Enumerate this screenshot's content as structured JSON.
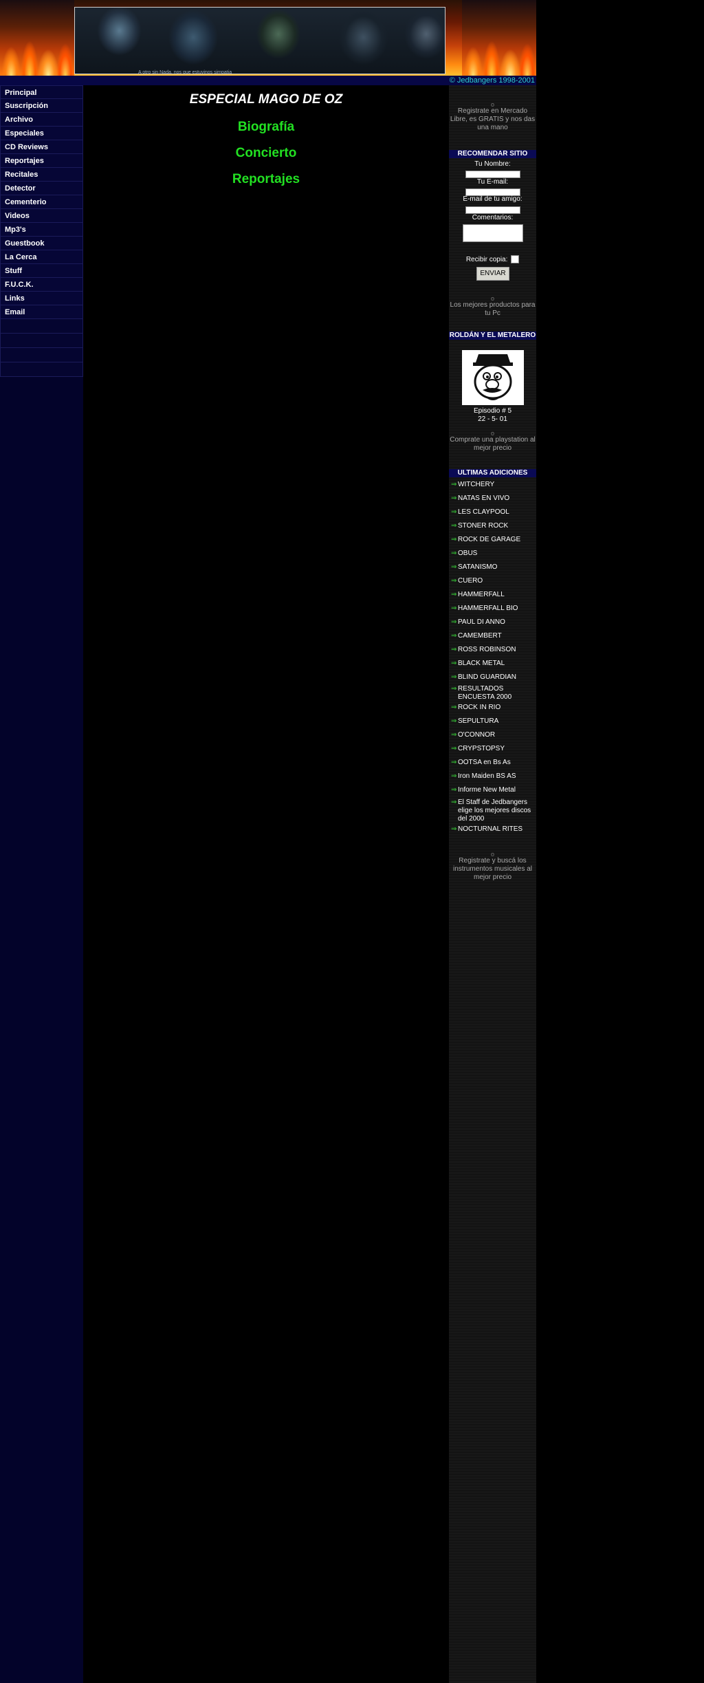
{
  "header": {
    "banner_caption": "A otro sin Nada, nos que estuvinos simpatia"
  },
  "strip": {
    "copyright": "© Jedbangers 1998-2001"
  },
  "nav": {
    "items": [
      "Principal",
      "Suscripción",
      "Archivo",
      "Especiales",
      "CD Reviews",
      "Reportajes",
      "Recitales",
      "Detector",
      "Cementerio",
      "Videos",
      "Mp3's",
      "Guestbook",
      "La Cerca",
      "Stuff",
      "F.U.C.K.",
      "Links",
      "Email"
    ]
  },
  "center": {
    "title": "ESPECIAL MAGO DE OZ",
    "links": [
      "Biografía",
      "Concierto",
      "Reportajes"
    ]
  },
  "right": {
    "bullet": "o",
    "ad_mercadolibre": "Registrate en Mercado Libre, es GRATIS y nos das una mano",
    "recommend": {
      "header": "RECOMENDAR SITIO",
      "name_label": "Tu Nombre:",
      "email_label": "Tu E-mail:",
      "friend_label": "E-mail de tu amigo:",
      "comments_label": "Comentarios:",
      "copy_label": "Recibir copia:",
      "send_label": "ENVIAR"
    },
    "ad_pc": "Los mejores productos para tu Pc",
    "roldan": {
      "header": "ROLDÁN Y EL METALERO",
      "episode": "Episodio # 5",
      "date": "22 - 5- 01"
    },
    "ad_playstation": "Comprate una playstation al mejor precio",
    "additions": {
      "header": "ULTIMAS ADICIONES",
      "arrow": "⇒",
      "items": [
        "WITCHERY",
        "NATAS EN VIVO",
        "LES CLAYPOOL",
        "STONER ROCK",
        "ROCK DE GARAGE",
        "OBUS",
        "SATANISMO",
        "CUERO",
        "HAMMERFALL",
        "HAMMERFALL BIO",
        "PAUL DI ANNO",
        "CAMEMBERT",
        "ROSS ROBINSON",
        "BLACK METAL",
        "BLIND GUARDIAN",
        "RESULTADOS ENCUESTA 2000",
        "ROCK IN RIO",
        "SEPULTURA",
        "O'CONNOR",
        "CRYPSTOPSY",
        "OOTSA en Bs As",
        "Iron Maiden BS AS",
        "Informe New Metal",
        "El Staff de Jedbangers elige los mejores discos del 2000",
        "NOCTURNAL RITES"
      ]
    },
    "ad_instruments": "Registrate y buscá los instrumentos musicales al mejor precio"
  },
  "colors": {
    "link_green": "#22e022",
    "nav_bg": "#060636",
    "header_blue": "#0a0a55",
    "copyright_cyan": "#2fd0d0"
  }
}
